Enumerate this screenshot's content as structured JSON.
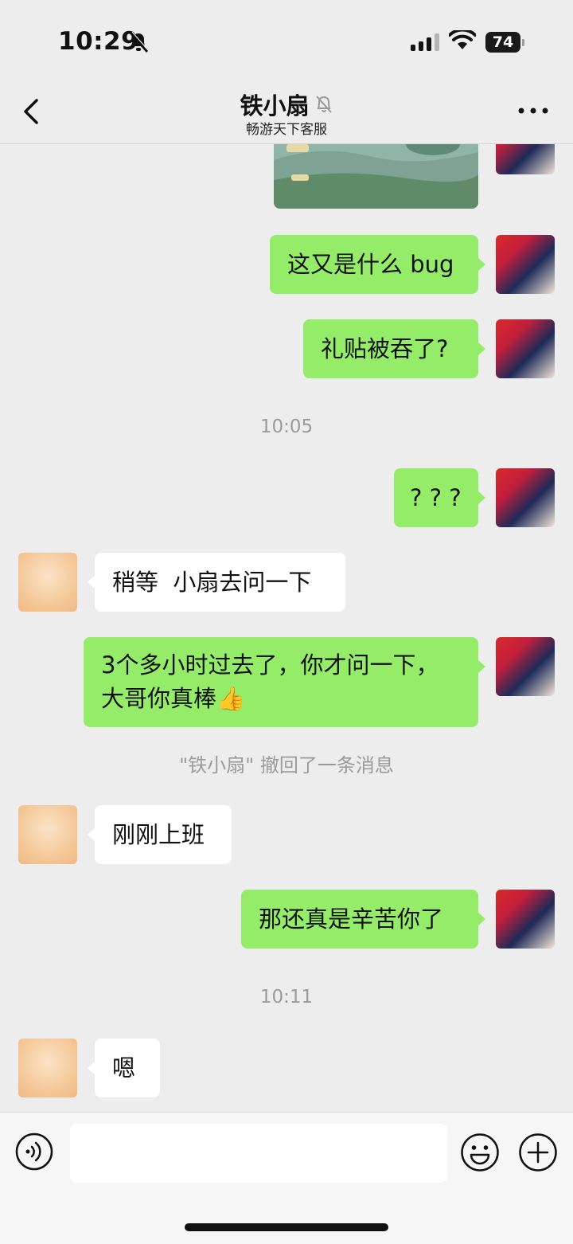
{
  "status_bar": {
    "time": "10:29",
    "battery": "74"
  },
  "header": {
    "title": "铁小扇",
    "subtitle": "畅游天下客服"
  },
  "messages": [
    {
      "side": "me",
      "type": "image"
    },
    {
      "side": "me",
      "text": "这又是什么 bug"
    },
    {
      "side": "me",
      "text": "礼贴被吞了?"
    },
    {
      "type": "timestamp",
      "text": "10:05"
    },
    {
      "side": "me",
      "text": "? ? ?"
    },
    {
      "side": "them",
      "text": "稍等  小扇去问一下"
    },
    {
      "side": "me",
      "line1": "3个多小时过去了，你才问一下，",
      "line2": "大哥你真棒",
      "emoji": "👍"
    },
    {
      "type": "system",
      "text": "\"铁小扇\" 撤回了一条消息"
    },
    {
      "side": "them",
      "text": "刚刚上班"
    },
    {
      "side": "me",
      "text": "那还真是辛苦你了"
    },
    {
      "type": "timestamp",
      "text": "10:11"
    },
    {
      "side": "them",
      "text": "嗯"
    }
  ],
  "input": {
    "value": ""
  },
  "colors": {
    "my_bubble": "#95ec69",
    "their_bubble": "#ffffff",
    "background": "#ededed"
  }
}
